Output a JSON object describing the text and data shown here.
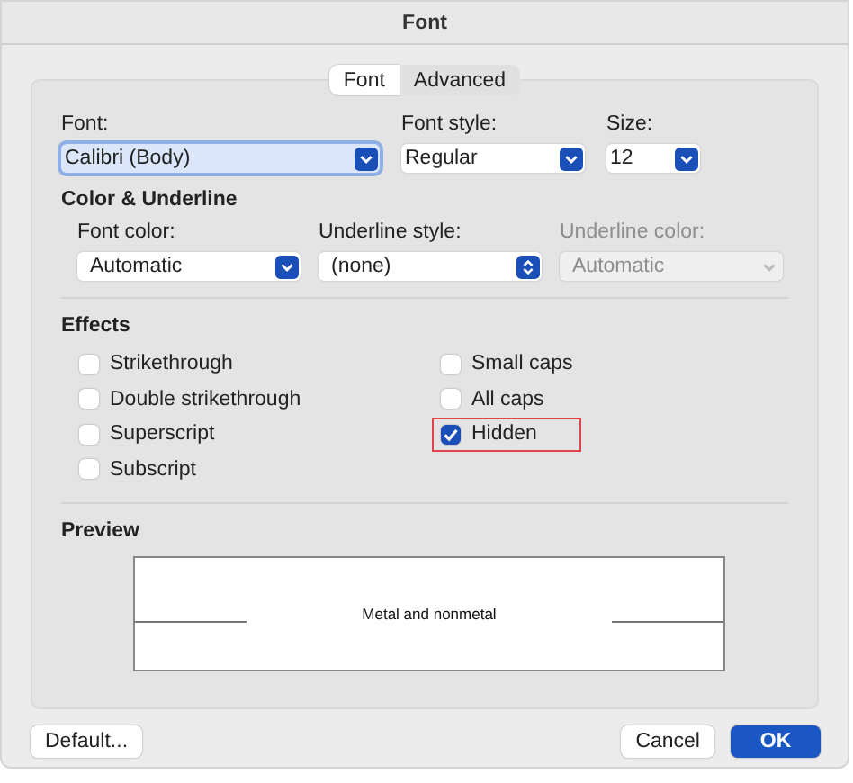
{
  "window": {
    "title": "Font"
  },
  "tabs": [
    {
      "label": "Font",
      "selected": true
    },
    {
      "label": "Advanced",
      "selected": false
    }
  ],
  "font_row": [
    {
      "label": "Font:",
      "value": "Calibri (Body)",
      "focused": true,
      "kind": "dropdown",
      "disabled": false
    },
    {
      "label": "Font style:",
      "value": "Regular",
      "focused": false,
      "kind": "dropdown",
      "disabled": false
    },
    {
      "label": "Size:",
      "value": "12",
      "focused": false,
      "kind": "dropdown",
      "disabled": false
    }
  ],
  "color_section": {
    "title": "Color & Underline",
    "fields": [
      {
        "label": "Font color:",
        "value": "Automatic",
        "focused": false,
        "kind": "dropdown",
        "disabled": false
      },
      {
        "label": "Underline style:",
        "value": "(none)",
        "focused": false,
        "kind": "stepper",
        "disabled": false
      },
      {
        "label": "Underline color:",
        "value": "Automatic",
        "focused": false,
        "kind": "dropdown",
        "disabled": true
      }
    ]
  },
  "effects": {
    "title": "Effects",
    "left": [
      {
        "label": "Strikethrough",
        "checked": false,
        "highlighted": false
      },
      {
        "label": "Double strikethrough",
        "checked": false,
        "highlighted": false
      },
      {
        "label": "Superscript",
        "checked": false,
        "highlighted": false
      },
      {
        "label": "Subscript",
        "checked": false,
        "highlighted": false
      }
    ],
    "right": [
      {
        "label": "Small caps",
        "checked": false,
        "highlighted": false
      },
      {
        "label": "All caps",
        "checked": false,
        "highlighted": false
      },
      {
        "label": "Hidden",
        "checked": true,
        "highlighted": true
      }
    ]
  },
  "preview": {
    "title": "Preview",
    "sample": "Metal and nonmetal"
  },
  "buttons": [
    {
      "label": "Default...",
      "primary": false
    },
    {
      "label": "Cancel",
      "primary": false
    },
    {
      "label": "OK",
      "primary": true
    }
  ]
}
